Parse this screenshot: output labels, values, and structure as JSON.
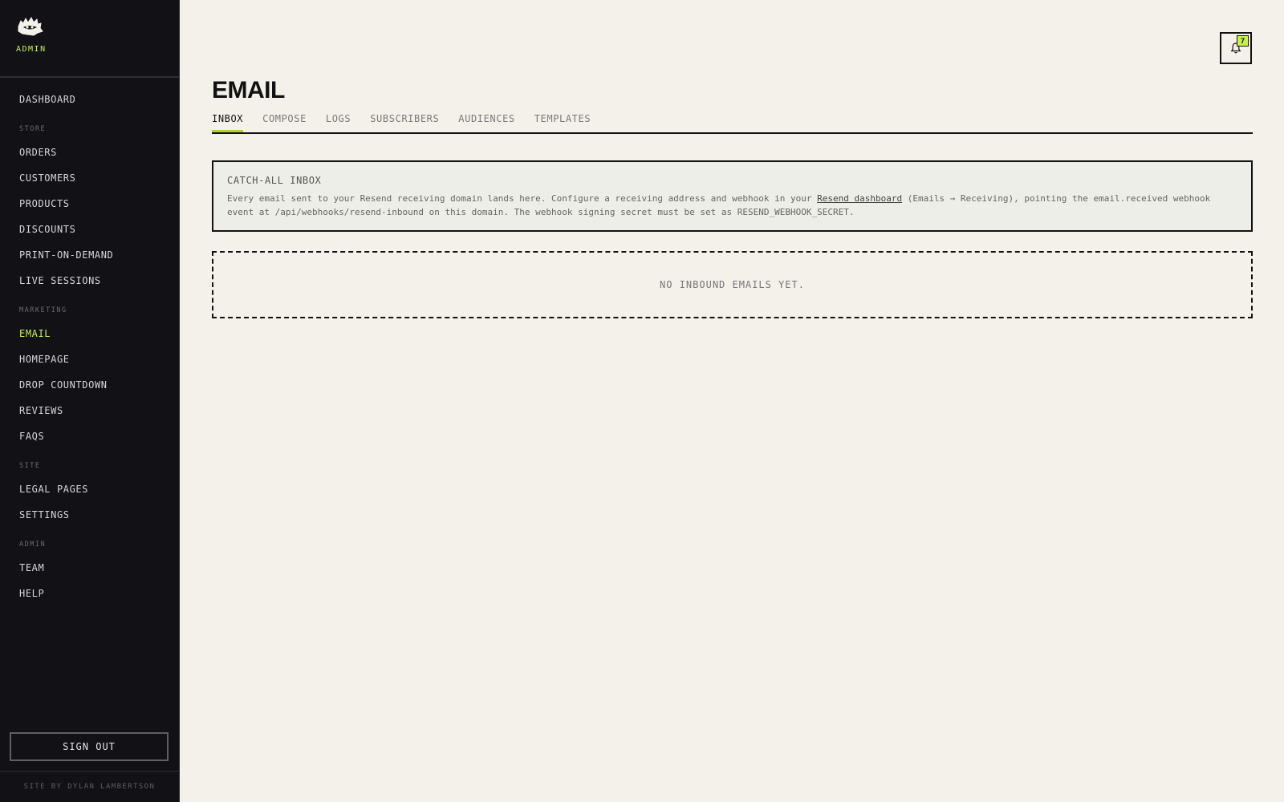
{
  "sidebar": {
    "role": "ADMIN",
    "items": [
      {
        "type": "item",
        "label": "DASHBOARD"
      },
      {
        "type": "section",
        "label": "STORE"
      },
      {
        "type": "item",
        "label": "ORDERS"
      },
      {
        "type": "item",
        "label": "CUSTOMERS"
      },
      {
        "type": "item",
        "label": "PRODUCTS"
      },
      {
        "type": "item",
        "label": "DISCOUNTS"
      },
      {
        "type": "item",
        "label": "PRINT-ON-DEMAND"
      },
      {
        "type": "item",
        "label": "LIVE SESSIONS"
      },
      {
        "type": "section",
        "label": "MARKETING"
      },
      {
        "type": "item",
        "label": "EMAIL",
        "active": true
      },
      {
        "type": "item",
        "label": "HOMEPAGE"
      },
      {
        "type": "item",
        "label": "DROP COUNTDOWN"
      },
      {
        "type": "item",
        "label": "REVIEWS"
      },
      {
        "type": "item",
        "label": "FAQS"
      },
      {
        "type": "section",
        "label": "SITE"
      },
      {
        "type": "item",
        "label": "LEGAL PAGES"
      },
      {
        "type": "item",
        "label": "SETTINGS"
      },
      {
        "type": "section",
        "label": "ADMIN"
      },
      {
        "type": "item",
        "label": "TEAM"
      },
      {
        "type": "item",
        "label": "HELP"
      }
    ],
    "signout_label": "SIGN OUT",
    "credit": "SITE BY DYLAN LAMBERTSON"
  },
  "header": {
    "notification_count": "7",
    "bell_icon": "bell-icon"
  },
  "page": {
    "title": "EMAIL",
    "tabs": [
      {
        "label": "INBOX",
        "active": true
      },
      {
        "label": "COMPOSE"
      },
      {
        "label": "LOGS"
      },
      {
        "label": "SUBSCRIBERS"
      },
      {
        "label": "AUDIENCES"
      },
      {
        "label": "TEMPLATES"
      }
    ]
  },
  "info": {
    "title": "CATCH-ALL INBOX",
    "text_before": "Every email sent to your Resend receiving domain lands here. Configure a receiving address and webhook in your ",
    "link_text": "Resend dashboard",
    "text_after": " (Emails → Receiving), pointing the email.received webhook event at /api/webhooks/resend-inbound on this domain. The webhook signing secret must be set as RESEND_WEBHOOK_SECRET."
  },
  "empty_state": "NO INBOUND EMAILS YET.",
  "colors": {
    "accent": "#c6f24a",
    "sidebar_bg": "#111116",
    "page_bg": "#f4f1ea"
  }
}
